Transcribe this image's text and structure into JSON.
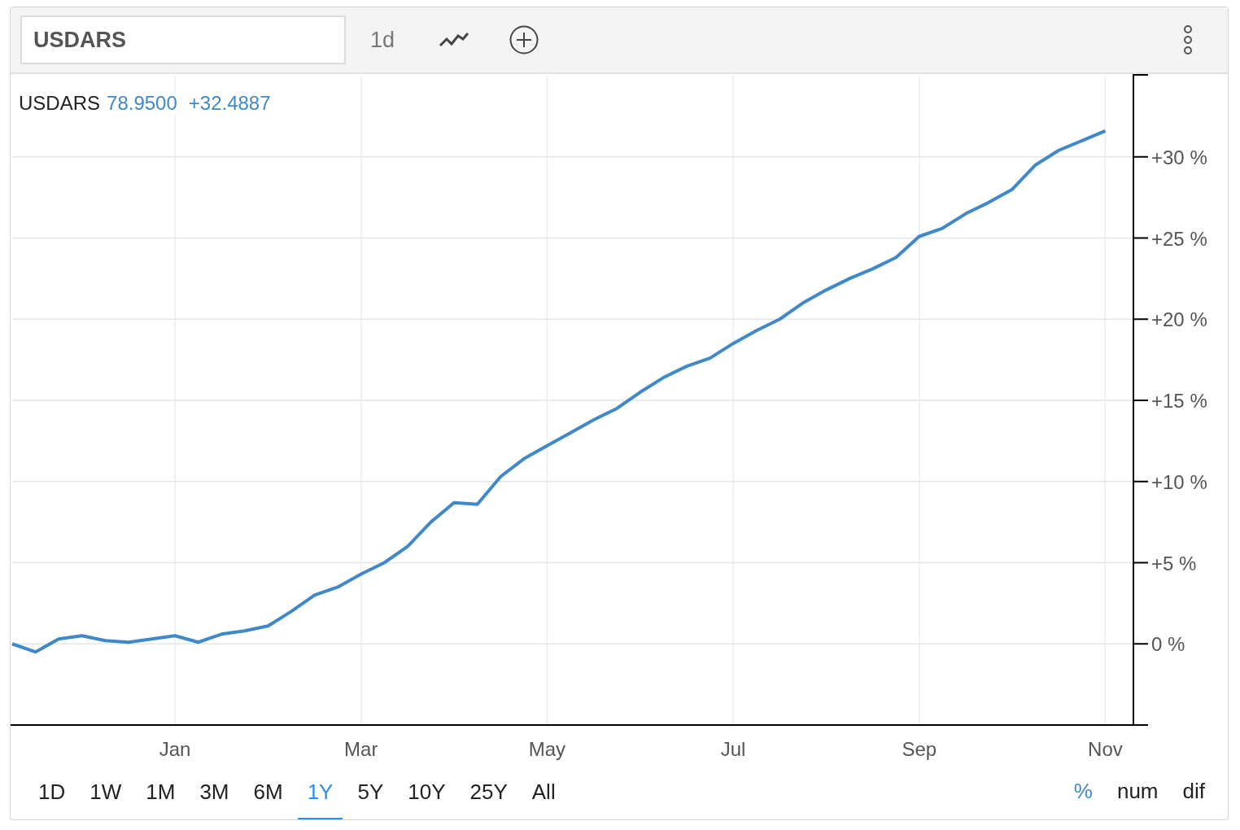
{
  "toolbar": {
    "symbol_field": {
      "value": "USDARS"
    },
    "interval": "1d"
  },
  "legend": {
    "price": "78.9500",
    "change": "+32.4887"
  },
  "chart_data": {
    "type": "line",
    "grid": true,
    "ylim": [
      -5,
      35
    ],
    "categories": [
      null,
      null,
      null,
      null,
      null,
      null,
      null,
      "Jan",
      null,
      null,
      null,
      null,
      null,
      null,
      null,
      "Mar",
      null,
      null,
      null,
      null,
      null,
      null,
      null,
      "May",
      null,
      null,
      null,
      null,
      null,
      null,
      null,
      "Jul",
      null,
      null,
      null,
      null,
      null,
      null,
      null,
      "Sep",
      null,
      null,
      null,
      null,
      null,
      null,
      null,
      "Nov",
      null
    ],
    "yticks": [
      {
        "value": 0,
        "label": "0 %"
      },
      {
        "value": 5,
        "label": "+5 %"
      },
      {
        "value": 10,
        "label": "+10 %"
      },
      {
        "value": 15,
        "label": "+15 %"
      },
      {
        "value": 20,
        "label": "+20 %"
      },
      {
        "value": 25,
        "label": "+25 %"
      },
      {
        "value": 30,
        "label": "+30 %"
      }
    ],
    "series": [
      {
        "name": "USDARS",
        "color": "#3f88c9",
        "values": [
          0,
          -0.5,
          0.3,
          0.5,
          0.2,
          0.1,
          0.3,
          0.5,
          0.1,
          0.6,
          0.8,
          1.1,
          2.0,
          3.0,
          3.5,
          4.3,
          5.0,
          6.0,
          7.5,
          8.7,
          8.6,
          10.3,
          11.4,
          12.2,
          13.0,
          13.8,
          14.5,
          15.5,
          16.4,
          17.1,
          17.6,
          18.5,
          19.3,
          20.0,
          21.0,
          21.8,
          22.5,
          23.1,
          23.8,
          25.1,
          25.6,
          26.5,
          27.2,
          28.0,
          29.5,
          30.4,
          31.0,
          31.6,
          null
        ]
      }
    ]
  },
  "ranges": [
    {
      "label": "1D",
      "selected": false
    },
    {
      "label": "1W",
      "selected": false
    },
    {
      "label": "1M",
      "selected": false
    },
    {
      "label": "3M",
      "selected": false
    },
    {
      "label": "6M",
      "selected": false
    },
    {
      "label": "1Y",
      "selected": true
    },
    {
      "label": "5Y",
      "selected": false
    },
    {
      "label": "10Y",
      "selected": false
    },
    {
      "label": "25Y",
      "selected": false
    },
    {
      "label": "All",
      "selected": false
    }
  ],
  "units": [
    {
      "label": "%",
      "selected": true
    },
    {
      "label": "num",
      "selected": false
    },
    {
      "label": "dif",
      "selected": false
    }
  ]
}
